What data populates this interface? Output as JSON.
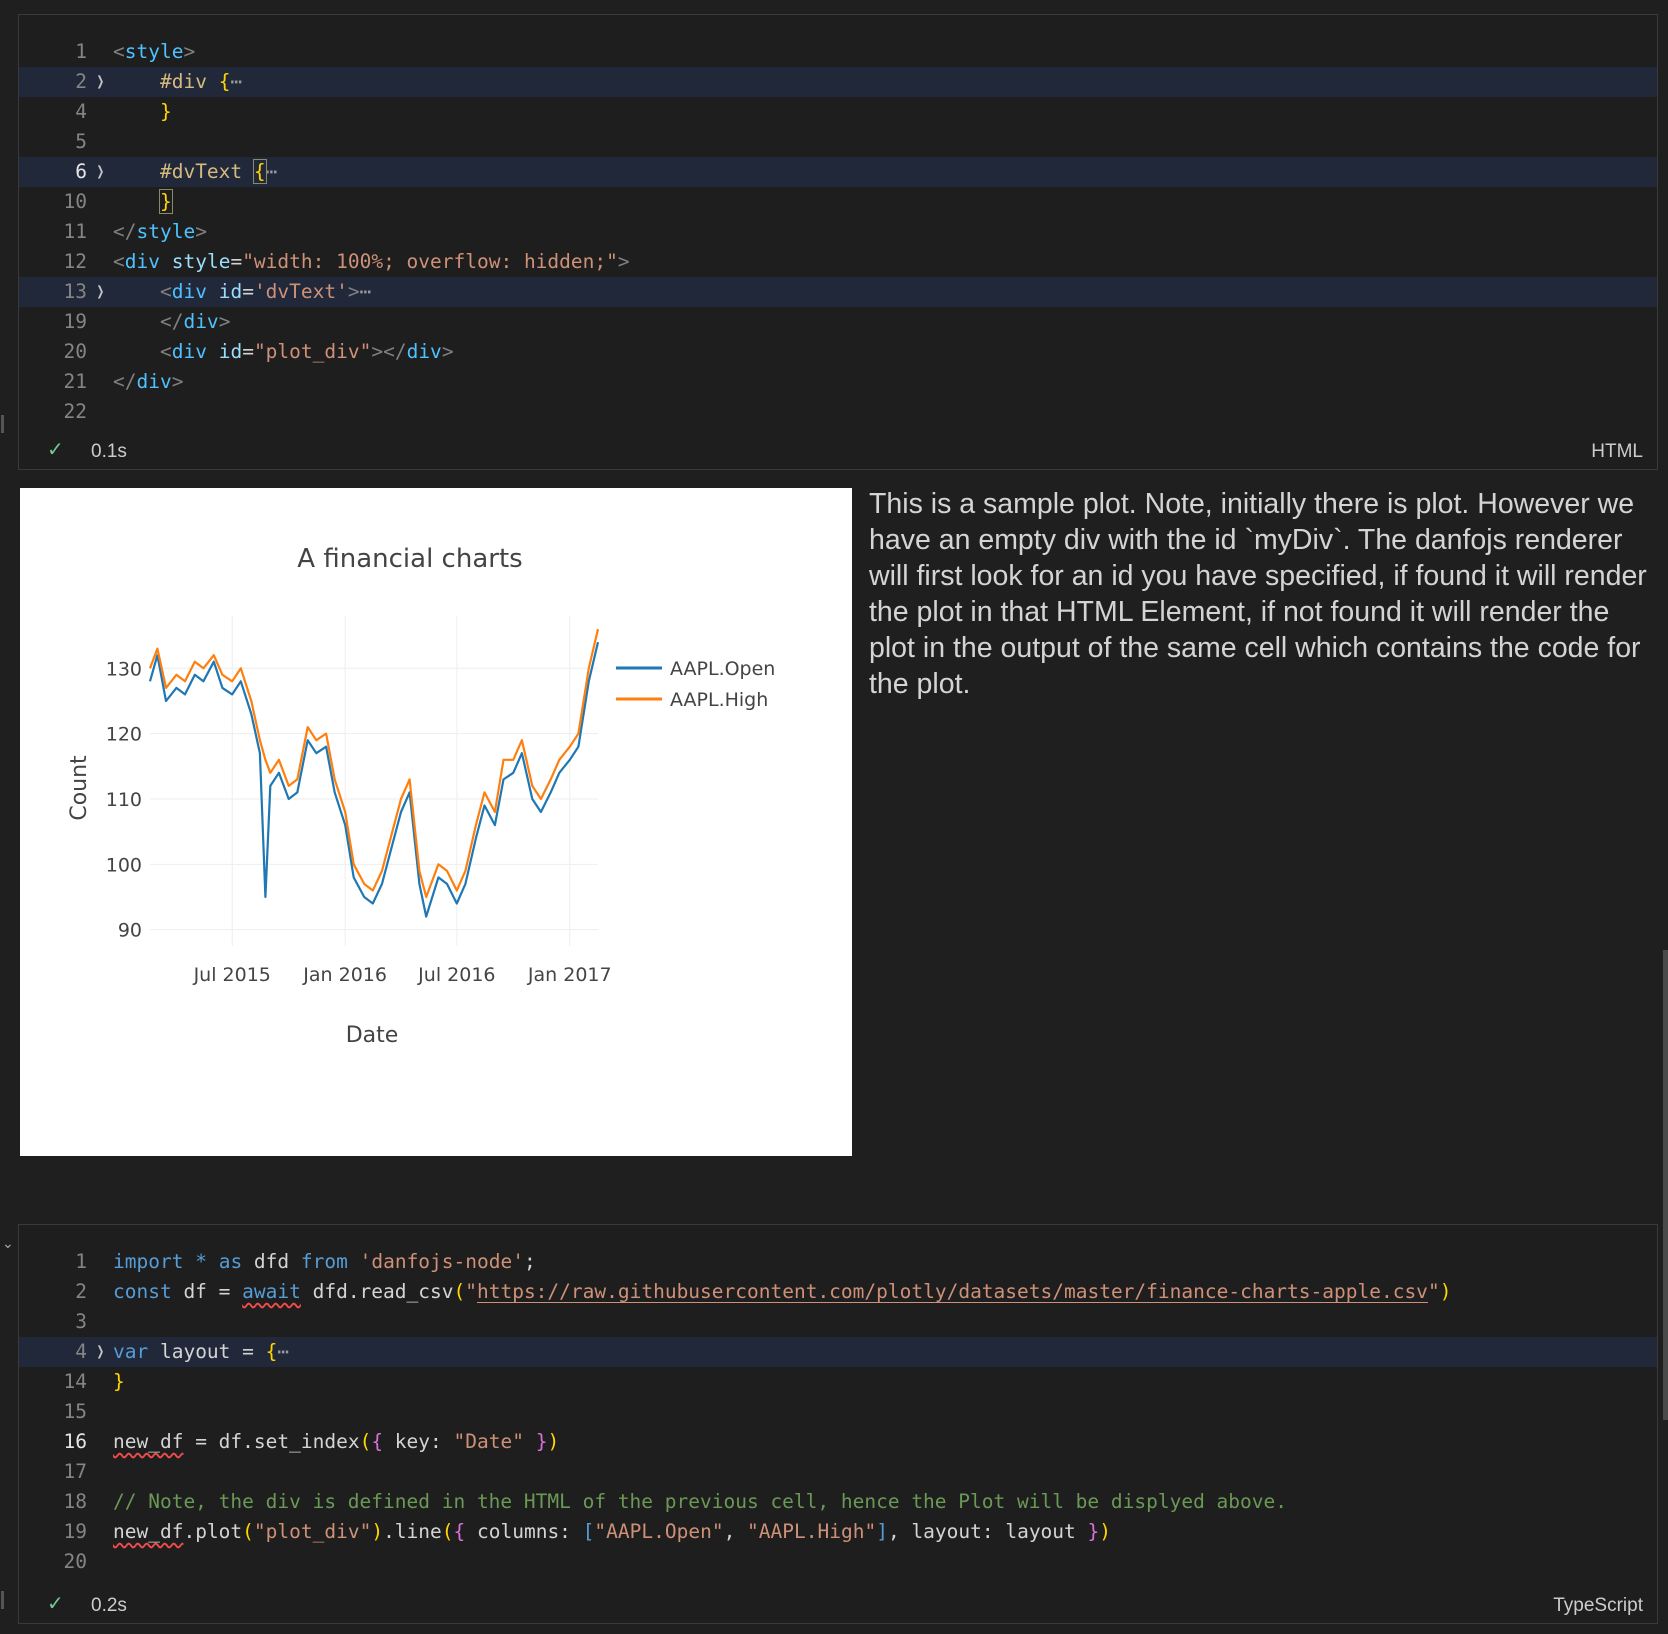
{
  "cell1": {
    "language": "HTML",
    "status_time": "0.1s",
    "lines": [
      {
        "n": "1",
        "segs": [
          [
            "ang",
            "<"
          ],
          [
            "tag",
            "style"
          ],
          [
            "ang",
            ">"
          ]
        ]
      },
      {
        "n": "2",
        "fold": true,
        "hl": true,
        "segs": [
          [
            "",
            "    "
          ],
          [
            "sel",
            "#div"
          ],
          [
            "",
            " "
          ],
          [
            "br",
            "{"
          ],
          [
            "dots",
            "⋯"
          ]
        ]
      },
      {
        "n": "4",
        "segs": [
          [
            "",
            "    "
          ],
          [
            "br",
            "}"
          ]
        ]
      },
      {
        "n": "5",
        "segs": []
      },
      {
        "n": "6",
        "fold": true,
        "hl": true,
        "cur": true,
        "segs": [
          [
            "",
            "    "
          ],
          [
            "sel",
            "#dvText"
          ],
          [
            "",
            " "
          ],
          [
            "br boxed",
            "{"
          ],
          [
            "dots",
            "⋯"
          ]
        ]
      },
      {
        "n": "10",
        "segs": [
          [
            "",
            "    "
          ],
          [
            "br boxed",
            "}"
          ]
        ]
      },
      {
        "n": "11",
        "segs": [
          [
            "ang",
            "</"
          ],
          [
            "tag",
            "style"
          ],
          [
            "ang",
            ">"
          ]
        ]
      },
      {
        "n": "12",
        "segs": [
          [
            "ang",
            "<"
          ],
          [
            "tag",
            "div"
          ],
          [
            "",
            " "
          ],
          [
            "attr",
            "style"
          ],
          [
            "",
            "="
          ],
          [
            "str",
            "\"width: 100%; overflow: hidden;\""
          ],
          [
            "ang",
            ">"
          ]
        ]
      },
      {
        "n": "13",
        "fold": true,
        "hl": true,
        "segs": [
          [
            "",
            "    "
          ],
          [
            "ang",
            "<"
          ],
          [
            "tag",
            "div"
          ],
          [
            "",
            " "
          ],
          [
            "attr",
            "id"
          ],
          [
            "",
            "="
          ],
          [
            "str",
            "'dvText'"
          ],
          [
            "ang",
            ">"
          ],
          [
            "dots",
            "⋯"
          ]
        ]
      },
      {
        "n": "19",
        "segs": [
          [
            "",
            "    "
          ],
          [
            "ang",
            "</"
          ],
          [
            "tag",
            "div"
          ],
          [
            "ang",
            ">"
          ]
        ]
      },
      {
        "n": "20",
        "segs": [
          [
            "",
            "    "
          ],
          [
            "ang",
            "<"
          ],
          [
            "tag",
            "div"
          ],
          [
            "",
            " "
          ],
          [
            "attr",
            "id"
          ],
          [
            "",
            "="
          ],
          [
            "str",
            "\"plot_div\""
          ],
          [
            "ang",
            "></"
          ],
          [
            "tag",
            "div"
          ],
          [
            "ang",
            ">"
          ]
        ]
      },
      {
        "n": "21",
        "segs": [
          [
            "ang",
            "</"
          ],
          [
            "tag",
            "div"
          ],
          [
            "ang",
            ">"
          ]
        ]
      },
      {
        "n": "22",
        "segs": []
      }
    ]
  },
  "cell2": {
    "language": "TypeScript",
    "status_time": "0.2s",
    "lines": [
      {
        "n": "1",
        "segs": [
          [
            "kw",
            "import"
          ],
          [
            "",
            " "
          ],
          [
            "kw",
            "*"
          ],
          [
            "",
            " "
          ],
          [
            "kw",
            "as"
          ],
          [
            "",
            " dfd "
          ],
          [
            "kw",
            "from"
          ],
          [
            "",
            " "
          ],
          [
            "str",
            "'danfojs-node'"
          ],
          [
            "",
            ";"
          ]
        ]
      },
      {
        "n": "2",
        "segs": [
          [
            "kw",
            "const"
          ],
          [
            "",
            " df = "
          ],
          [
            "kw squig",
            "await"
          ],
          [
            "",
            " dfd.read_csv"
          ],
          [
            "br",
            "("
          ],
          [
            "str",
            "\""
          ],
          [
            "str url",
            "https://raw.githubusercontent.com/plotly/datasets/master/finance-charts-apple.csv"
          ],
          [
            "str",
            "\""
          ],
          [
            "br",
            ")"
          ]
        ]
      },
      {
        "n": "3",
        "segs": []
      },
      {
        "n": "4",
        "fold": true,
        "hl": true,
        "segs": [
          [
            "kw",
            "var"
          ],
          [
            "",
            " layout = "
          ],
          [
            "br",
            "{"
          ],
          [
            "dots",
            "⋯"
          ]
        ]
      },
      {
        "n": "14",
        "segs": [
          [
            "br",
            "}"
          ]
        ]
      },
      {
        "n": "15",
        "segs": []
      },
      {
        "n": "16",
        "cur": true,
        "segs": [
          [
            "squig",
            "new_df"
          ],
          [
            "",
            " = df.set_index"
          ],
          [
            "br",
            "("
          ],
          [
            "br2",
            "{"
          ],
          [
            "",
            " key: "
          ],
          [
            "str",
            "\"Date\""
          ],
          [
            "",
            " "
          ],
          [
            "br2",
            "}"
          ],
          [
            "br",
            ")"
          ]
        ]
      },
      {
        "n": "17",
        "segs": []
      },
      {
        "n": "18",
        "segs": [
          [
            "cm",
            "// Note, the div is defined in the HTML of the previous cell, hence the Plot will be displyed above."
          ]
        ]
      },
      {
        "n": "19",
        "segs": [
          [
            "squig",
            "new_df"
          ],
          [
            ".plot"
          ],
          [
            "br",
            "("
          ],
          [
            "str",
            "\"plot_div\""
          ],
          [
            "br",
            ")"
          ],
          [
            ".line"
          ],
          [
            "br",
            "("
          ],
          [
            "br2",
            "{"
          ],
          [
            "",
            " columns: "
          ],
          [
            "kw",
            "["
          ],
          [
            "str",
            "\"AAPL.Open\""
          ],
          [
            ", "
          ],
          [
            "str",
            "\"AAPL.High\""
          ],
          [
            "kw",
            "]"
          ],
          [
            ", layout: layout "
          ],
          [
            "br2",
            "}"
          ],
          [
            "br",
            ")"
          ]
        ]
      },
      {
        "n": "20",
        "segs": []
      }
    ]
  },
  "notes": "This is a sample plot. Note, initially there is plot. However we have an empty div with the id `myDiv`. The danfojs renderer will first look for an id you have specified, if found it will render the plot in that HTML Element, if not found it will render the plot in the output of the same cell which contains the code for the plot.",
  "colors": {
    "open": "#1f77b4",
    "high": "#ff7f0e"
  },
  "chart_data": {
    "type": "line",
    "title": "A financial charts",
    "xlabel": "Date",
    "ylabel": "Count",
    "x_ticks": [
      "Jul 2015",
      "Jan 2016",
      "Jul 2016",
      "Jan 2017"
    ],
    "y_ticks": [
      90,
      100,
      110,
      120,
      130
    ],
    "ylim": [
      87.5,
      138
    ],
    "xlim": [
      "2015-02-17",
      "2017-02-16"
    ],
    "legend_position": "top-right",
    "grid": true,
    "x": [
      "2015-02-17",
      "2015-03-01",
      "2015-03-15",
      "2015-04-01",
      "2015-04-15",
      "2015-05-01",
      "2015-05-15",
      "2015-06-01",
      "2015-06-15",
      "2015-07-01",
      "2015-07-15",
      "2015-08-01",
      "2015-08-15",
      "2015-08-24",
      "2015-09-01",
      "2015-09-15",
      "2015-10-01",
      "2015-10-15",
      "2015-11-01",
      "2015-11-15",
      "2015-12-01",
      "2015-12-15",
      "2016-01-01",
      "2016-01-15",
      "2016-02-01",
      "2016-02-15",
      "2016-03-01",
      "2016-03-15",
      "2016-04-01",
      "2016-04-15",
      "2016-05-01",
      "2016-05-12",
      "2016-06-01",
      "2016-06-15",
      "2016-07-01",
      "2016-07-15",
      "2016-08-01",
      "2016-08-15",
      "2016-09-01",
      "2016-09-15",
      "2016-10-01",
      "2016-10-15",
      "2016-11-01",
      "2016-11-15",
      "2016-12-01",
      "2016-12-15",
      "2017-01-01",
      "2017-01-15",
      "2017-02-01",
      "2017-02-16"
    ],
    "series": [
      {
        "name": "AAPL.Open",
        "values": [
          128,
          132,
          125,
          127,
          126,
          129,
          128,
          131,
          127,
          126,
          128,
          123,
          117,
          95,
          112,
          114,
          110,
          111,
          119,
          117,
          118,
          111,
          106,
          98,
          95,
          94,
          97,
          102,
          108,
          111,
          97,
          92,
          98,
          97,
          94,
          97,
          104,
          109,
          106,
          113,
          114,
          117,
          110,
          108,
          111,
          114,
          116,
          118,
          128,
          134
        ]
      },
      {
        "name": "AAPL.High",
        "values": [
          130,
          133,
          127,
          129,
          128,
          131,
          130,
          132,
          129,
          128,
          130,
          125,
          119,
          116,
          114,
          116,
          112,
          113,
          121,
          119,
          120,
          113,
          108,
          100,
          97,
          96,
          99,
          104,
          110,
          113,
          99,
          95,
          100,
          99,
          96,
          99,
          106,
          111,
          108,
          116,
          116,
          119,
          112,
          110,
          113,
          116,
          118,
          120,
          130,
          136
        ]
      }
    ]
  }
}
